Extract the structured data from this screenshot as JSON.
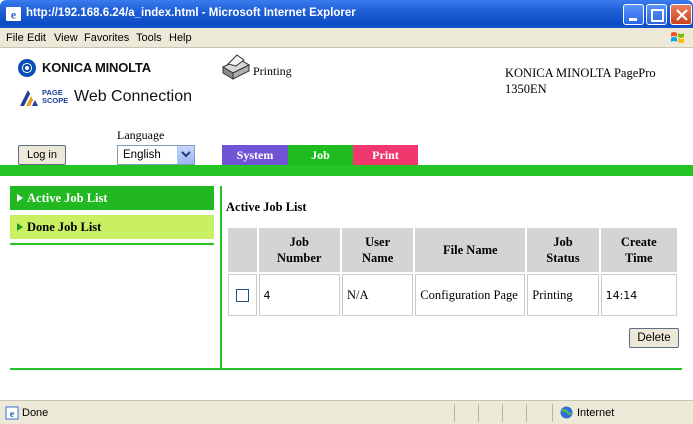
{
  "window": {
    "title": "http://192.168.6.24/a_index.html - Microsoft Internet Explorer"
  },
  "menu": [
    "File",
    "Edit",
    "View",
    "Favorites",
    "Tools",
    "Help"
  ],
  "header": {
    "brand": "KONICA MINOLTA",
    "pagescope": "PAGE SCOPE",
    "product": "Web Connection",
    "printer_status": "Printing",
    "model_line1": "KONICA MINOLTA PagePro",
    "model_line2": "1350EN"
  },
  "controls": {
    "login_label": "Log in",
    "language_label": "Language",
    "language_value": "English"
  },
  "tabs": [
    {
      "label": "System",
      "color": "#7153d6"
    },
    {
      "label": "Job",
      "color": "#1ebc1e"
    },
    {
      "label": "Print",
      "color": "#f0386e"
    }
  ],
  "nav": {
    "items": [
      {
        "label": "Active Job List",
        "state": "active"
      },
      {
        "label": "Done Job List",
        "state": "normal"
      }
    ]
  },
  "content": {
    "title": "Active Job List",
    "table": {
      "headers": [
        "",
        "Job Number",
        "User Name",
        "File Name",
        "Job Status",
        "Create Time"
      ],
      "rows": [
        {
          "checked": false,
          "job_number": "4",
          "user_name": "N/A",
          "file_name": "Configuration Page",
          "job_status": "Printing",
          "create_time": "14:14"
        }
      ]
    },
    "delete_label": "Delete"
  },
  "statusbar": {
    "left": "Done",
    "zone": "Internet"
  },
  "colors": {
    "accent_green": "#25c425",
    "nav_active": "#22b822",
    "nav_done": "#c9ef63"
  }
}
